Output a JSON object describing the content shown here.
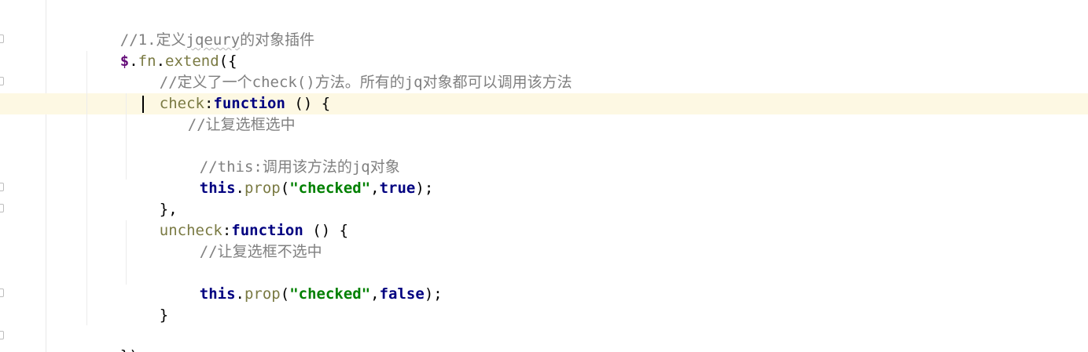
{
  "code": {
    "line1_comment": "//1.定义",
    "line1_squiggle": "jqeury",
    "line1_rest": "的对象插件",
    "line2_dollar": "$",
    "line2_dot1": ".",
    "line2_fn": "fn",
    "line2_dot2": ".",
    "line2_extend": "extend",
    "line2_open": "({",
    "line3_comment": "//定义了一个check()方法。所有的jq对象都可以调用该方法",
    "line4_name": "check",
    "line4_colon": ":",
    "line4_keyword": "function",
    "line4_rest": " () {",
    "line5_comment": "//让复选框选中",
    "line7_comment": "//this:调用该方法的jq对象",
    "line8_this": "this",
    "line8_dot": ".",
    "line8_method": "prop",
    "line8_open": "(",
    "line8_string": "\"checked\"",
    "line8_comma": ",",
    "line8_bool": "true",
    "line8_close": ");",
    "line9_close": "},",
    "line10_name": "uncheck",
    "line10_colon": ":",
    "line10_keyword": "function",
    "line10_rest": " () {",
    "line11_comment": "//让复选框不选中",
    "line13_this": "this",
    "line13_dot": ".",
    "line13_method": "prop",
    "line13_open": "(",
    "line13_string": "\"checked\"",
    "line13_comma": ",",
    "line13_bool": "false",
    "line13_close": ");",
    "line14_close": "}",
    "line16_close": "});"
  },
  "colors": {
    "comment": "#808080",
    "keyword": "#000080",
    "string": "#008000",
    "property": "#7a7a43",
    "caret_row": "#fdf8e3"
  }
}
